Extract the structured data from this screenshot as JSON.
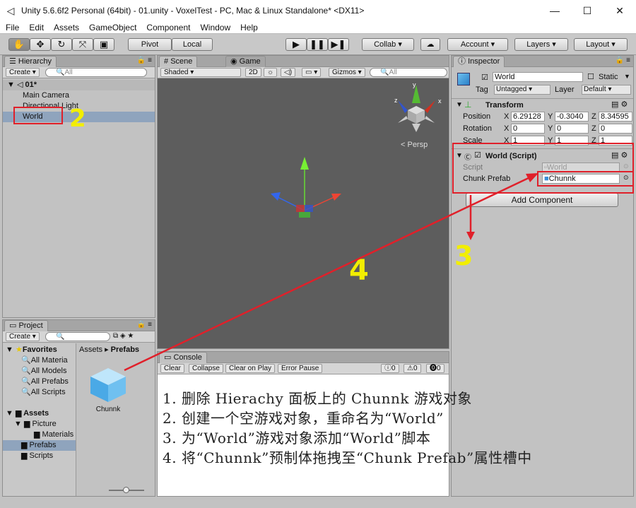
{
  "window": {
    "title": "Unity 5.6.6f2 Personal (64bit) - 01.unity - VoxelTest - PC, Mac & Linux Standalone* <DX11>",
    "minimize": "—",
    "maximize": "☐",
    "close": "✕"
  },
  "menu": [
    "File",
    "Edit",
    "Assets",
    "GameObject",
    "Component",
    "Window",
    "Help"
  ],
  "toolbar": {
    "pivot": "Pivot",
    "local": "Local",
    "collab": "Collab ▾",
    "account": "Account",
    "layers": "Layers",
    "layout": "Layout"
  },
  "hierarchy": {
    "tab": "Hierarchy",
    "create": "Create ▾",
    "search": "All",
    "scene": "01*",
    "items": [
      "Main Camera",
      "Directional Light",
      "World"
    ]
  },
  "scene": {
    "tab_scene": "Scene",
    "tab_game": "Game",
    "shading": "Shaded",
    "mode2d": "2D",
    "gizmos": "Gizmos ▾",
    "search": "All",
    "persp": "< Persp",
    "gizmo_x": "x",
    "gizmo_y": "y",
    "gizmo_z": "z"
  },
  "inspector": {
    "tab": "Inspector",
    "name": "World",
    "static": "Static",
    "tag_label": "Tag",
    "tag": "Untagged",
    "layer_label": "Layer",
    "layer": "Default",
    "transform": {
      "title": "Transform",
      "position": "Position",
      "rotation": "Rotation",
      "scale": "Scale",
      "pos": [
        "6.29128",
        "-0.3040",
        "8.34595"
      ],
      "rot": [
        "0",
        "0",
        "0"
      ],
      "scl": [
        "1",
        "1",
        "1"
      ],
      "axes": [
        "X",
        "Y",
        "Z"
      ]
    },
    "script": {
      "title": "World (Script)",
      "script_label": "Script",
      "script_value": "World",
      "prefab_label": "Chunk Prefab",
      "prefab_value": "Chunnk"
    },
    "add_component": "Add Component"
  },
  "project": {
    "tab": "Project",
    "create": "Create ▾",
    "favorites": "Favorites",
    "fav_items": [
      "All Materia",
      "All Models",
      "All Prefabs",
      "All Scripts"
    ],
    "assets": "Assets",
    "tree": [
      "Picture",
      "Materials",
      "Prefabs",
      "Scripts"
    ],
    "breadcrumb": [
      "Assets",
      "▸",
      "Prefabs"
    ],
    "asset_name": "Chunnk"
  },
  "console": {
    "tab": "Console",
    "buttons": [
      "Clear",
      "Collapse",
      "Clear on Play",
      "Error Pause"
    ],
    "counts": [
      "0",
      "0",
      "0"
    ]
  },
  "annotations": {
    "marks": [
      "2",
      "3",
      "4"
    ],
    "steps": [
      "1. 删除 Hierachy 面板上的 Chunnk 游戏对象",
      "2. 创建一个空游戏对象，重命名为“World”",
      "3. 为“World”游戏对象添加“World”脚本",
      "4. 将“Chunnk”预制体拖拽至“Chunk Prefab”属性槽中"
    ]
  },
  "colors": {
    "annotation_red": "#e0202a",
    "annotation_yellow": "#f2ee00",
    "selection": "#8fa4bd",
    "scene_bg": "#5d5d5d"
  }
}
